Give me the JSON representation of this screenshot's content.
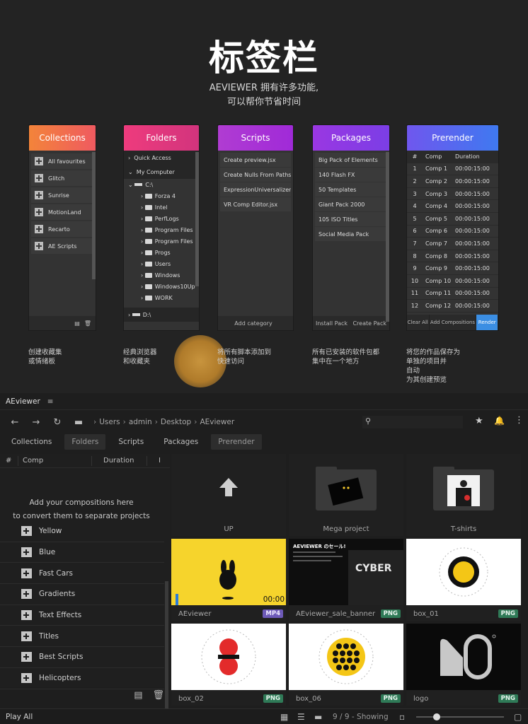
{
  "promo": {
    "headline": "标签栏",
    "subtitle_line1": "AEVIEWER 拥有许多功能,",
    "subtitle_line2": "可以帮你节省时间",
    "cards": {
      "collections": {
        "title": "Collections",
        "items": [
          "All favourites",
          "Glitch",
          "Sunrise",
          "MotionLand",
          "Recarto",
          "AE Scripts"
        ]
      },
      "folders": {
        "title": "Folders",
        "quick_access": "Quick Access",
        "my_computer": "My Computer",
        "drive_c": "C:\\",
        "subfolders": [
          "Forza 4",
          "Intel",
          "PerfLogs",
          "Program Files",
          "Program Files",
          "Progs",
          "Users",
          "Windows",
          "Windows10Up",
          "WORK"
        ],
        "drive_d": "D:\\"
      },
      "scripts": {
        "title": "Scripts",
        "items": [
          "Create preview.jsx",
          "Create Nulls From Paths.jsx",
          "ExpressionUniversalizer.jsx",
          "VR Comp Editor.jsx"
        ],
        "footer": "Add category"
      },
      "packages": {
        "title": "Packages",
        "items": [
          "Big Pack of Elements",
          "140 Flash FX",
          "50 Templates",
          "Giant Pack 2000",
          "105 ISO Titles",
          "Social Media Pack"
        ],
        "install": "Install Pack",
        "create": "Create Pack"
      },
      "prerender": {
        "title": "Prerender",
        "headers": [
          "#",
          "Comp",
          "Duration"
        ],
        "rows": [
          [
            "1",
            "Comp 1",
            "00:00:15:00"
          ],
          [
            "2",
            "Comp 2",
            "00:00:15:00"
          ],
          [
            "3",
            "Comp 3",
            "00:00:15:00"
          ],
          [
            "4",
            "Comp 4",
            "00:00:15:00"
          ],
          [
            "5",
            "Comp 5",
            "00:00:15:00"
          ],
          [
            "6",
            "Comp 6",
            "00:00:15:00"
          ],
          [
            "7",
            "Comp 7",
            "00:00:15:00"
          ],
          [
            "8",
            "Comp 8",
            "00:00:15:00"
          ],
          [
            "9",
            "Comp 9",
            "00:00:15:00"
          ],
          [
            "10",
            "Comp 10",
            "00:00:15:00"
          ],
          [
            "11",
            "Comp 11",
            "00:00:15:00"
          ],
          [
            "12",
            "Comp 12",
            "00:00:15:00"
          ]
        ],
        "clear_all": "Clear All",
        "add_compositions": "Add Compositions",
        "render": "Render"
      }
    },
    "captions": [
      [
        "创建收藏集",
        "或情绪板"
      ],
      [
        "经典浏览器",
        "和收藏夹"
      ],
      [
        "将所有脚本添加到",
        "快速访问"
      ],
      [
        "所有已安装的软件包都",
        "集中在一个地方"
      ],
      [
        "将您的作品保存为",
        "单独的项目并",
        "自动",
        "为其创建预览"
      ]
    ]
  },
  "app": {
    "title": "AEviewer",
    "breadcrumb": [
      "Users",
      "admin",
      "Desktop",
      "AEviewer"
    ],
    "tabs": [
      "Collections",
      "Folders",
      "Scripts",
      "Packages",
      "Prerender"
    ],
    "selected_tabs": [
      "Folders",
      "Prerender"
    ],
    "columns": [
      "#",
      "Comp",
      "Duration",
      "I"
    ],
    "empty_line1": "Add your compositions here",
    "empty_line2": "to convert them to separate projects",
    "collections": [
      "Yellow",
      "Blue",
      "Fast Cars",
      "Gradients",
      "Text Effects",
      "Titles",
      "Best Scripts",
      "Helicopters"
    ],
    "tiles": [
      {
        "label": "UP"
      },
      {
        "label": "Mega project"
      },
      {
        "label": "T-shirts"
      },
      {
        "label": "AEviewer",
        "badge": "MP4",
        "time": "00:00"
      },
      {
        "label": "AEviewer_sale_banner",
        "badge": "PNG",
        "banner_title": "AEVIEWER のセール!",
        "banner_word": "CYBER"
      },
      {
        "label": "box_01",
        "badge": "PNG"
      },
      {
        "label": "box_02",
        "badge": "PNG"
      },
      {
        "label": "box_06",
        "badge": "PNG"
      },
      {
        "label": "logo",
        "badge": "PNG"
      }
    ],
    "status": {
      "play_all": "Play All",
      "count": "9 / 9 - Showing"
    },
    "colors": {
      "accent_blue": "#3b8ee3",
      "badge_png": "#2f7a57",
      "badge_mp4": "#6d5ab8",
      "yellow_thumb": "#f6d42c"
    }
  }
}
